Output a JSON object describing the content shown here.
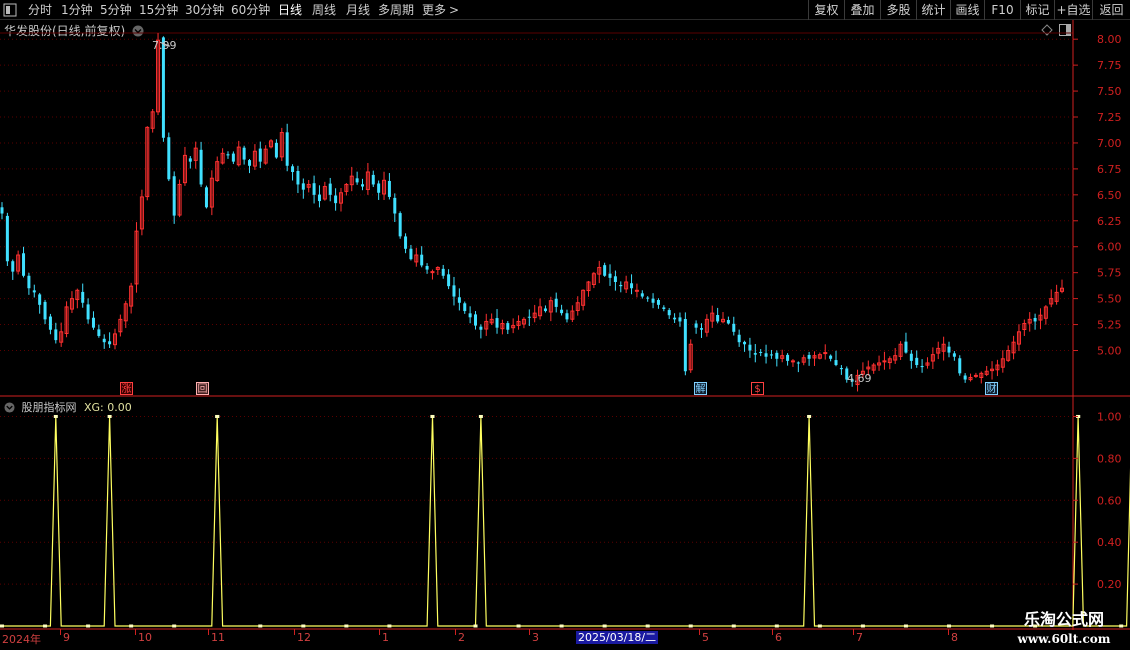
{
  "toolbar": {
    "periods": [
      "分时",
      "1分钟",
      "5分钟",
      "15分钟",
      "30分钟",
      "60分钟",
      "日线",
      "周线",
      "月线",
      "多周期",
      "更多"
    ],
    "more_arrow": ">",
    "active_index": 6,
    "right_buttons": [
      "复权",
      "叠加",
      "多股",
      "统计",
      "画线",
      "F10",
      "标记",
      "+自选",
      "返回"
    ]
  },
  "main_panel": {
    "title": "华发股份(日线,前复权)",
    "high_label": "7.99",
    "low_label": "4.69",
    "events": [
      {
        "label": "涨",
        "color": "#ff4040",
        "bg": "#3a0000"
      },
      {
        "label": "回",
        "color": "#ffb0b0",
        "bg": "#402020"
      },
      {
        "label": "解",
        "color": "#80d0ff",
        "bg": "#102030"
      },
      {
        "label": "$",
        "color": "#ff4040",
        "bg": "#000000"
      },
      {
        "label": "财",
        "color": "#80d0ff",
        "bg": "#102030"
      }
    ]
  },
  "indicator_panel": {
    "name": "股朋指标网",
    "xg_label": "XG: 0.00"
  },
  "date_axis": {
    "labels": [
      "2024年",
      "9",
      "10",
      "11",
      "12",
      "1",
      "2",
      "3",
      "2025/03/18/二",
      "5",
      "6",
      "7",
      "8"
    ]
  },
  "watermark": {
    "line1": "乐淘公式网",
    "line2": "www.60lt.com"
  },
  "colors": {
    "up": "#ff3030",
    "down": "#40e0ff",
    "axis": "#d02020",
    "indicator": "#ffff60",
    "grid": "#5a0000"
  },
  "chart_data": [
    {
      "type": "candlestick",
      "title": "华发股份(日线,前复权)",
      "ylim": [
        4.6,
        8.05
      ],
      "y_ticks": [
        8.0,
        7.75,
        7.5,
        7.25,
        7.0,
        6.75,
        6.5,
        6.25,
        6.0,
        5.75,
        5.5,
        5.25,
        5.0
      ],
      "x_month_labels": [
        "2024年",
        "9",
        "10",
        "11",
        "12",
        "1",
        "2",
        "3",
        "5",
        "6",
        "7",
        "8"
      ],
      "annotations": [
        {
          "text": "7.99",
          "value": 7.99
        },
        {
          "text": "4.69",
          "value": 4.69
        }
      ],
      "close": [
        6.32,
        5.86,
        5.76,
        5.92,
        5.72,
        5.6,
        5.56,
        5.44,
        5.3,
        5.2,
        5.1,
        5.18,
        5.42,
        5.5,
        5.58,
        5.46,
        5.3,
        5.22,
        5.14,
        5.08,
        5.06,
        5.16,
        5.3,
        5.45,
        5.62,
        6.15,
        6.48,
        7.15,
        7.3,
        7.99,
        7.05,
        6.65,
        6.3,
        6.6,
        6.88,
        6.82,
        6.95,
        6.6,
        6.38,
        6.66,
        6.82,
        6.9,
        6.88,
        6.82,
        6.96,
        6.84,
        6.78,
        6.92,
        6.82,
        6.94,
        7.02,
        6.86,
        7.1,
        6.78,
        6.72,
        6.6,
        6.55,
        6.6,
        6.5,
        6.44,
        6.58,
        6.5,
        6.42,
        6.52,
        6.6,
        6.68,
        6.62,
        6.58,
        6.72,
        6.6,
        6.52,
        6.64,
        6.48,
        6.32,
        6.1,
        5.98,
        5.88,
        5.92,
        5.82,
        5.78,
        5.76,
        5.8,
        5.72,
        5.62,
        5.52,
        5.46,
        5.38,
        5.32,
        5.24,
        5.2,
        5.28,
        5.3,
        5.22,
        5.26,
        5.2,
        5.24,
        5.28,
        5.3,
        5.32,
        5.36,
        5.42,
        5.38,
        5.48,
        5.42,
        5.36,
        5.3,
        5.38,
        5.46,
        5.58,
        5.66,
        5.74,
        5.8,
        5.72,
        5.7,
        5.66,
        5.62,
        5.66,
        5.6,
        5.58,
        5.52,
        5.5,
        5.46,
        5.44,
        5.4,
        5.34,
        5.3,
        5.28,
        4.8,
        5.06,
        5.22,
        5.2,
        5.3,
        5.36,
        5.28,
        5.3,
        5.26,
        5.18,
        5.08,
        5.06,
        5.0,
        4.96,
        4.98,
        4.94,
        4.96,
        4.92,
        4.95,
        4.9,
        4.9,
        4.88,
        4.93,
        4.92,
        4.95,
        4.96,
        4.98,
        4.92,
        4.86,
        4.82,
        4.72,
        4.7,
        4.76,
        4.8,
        4.84,
        4.86,
        4.88,
        4.9,
        4.92,
        4.95,
        5.06,
        4.98,
        4.9,
        4.86,
        4.84,
        4.88,
        4.96,
        5.02,
        5.06,
        4.98,
        4.94,
        4.78,
        4.72,
        4.74,
        4.76,
        4.78,
        4.8,
        4.82,
        4.86,
        4.92,
        5.0,
        5.08,
        5.18,
        5.26,
        5.3,
        5.28,
        5.34,
        5.42,
        5.5,
        5.56,
        5.6
      ]
    },
    {
      "type": "line",
      "title": "股朋指标网",
      "ylim": [
        0,
        1.05
      ],
      "y_ticks": [
        1.0,
        0.8,
        0.6,
        0.4,
        0.2
      ],
      "series": [
        {
          "name": "XG",
          "values": [
            0,
            0,
            0,
            0,
            0,
            0,
            0,
            0,
            0,
            0,
            1,
            0,
            0,
            0,
            0,
            0,
            0,
            0,
            0,
            0,
            1,
            0,
            0,
            0,
            0,
            0,
            0,
            0,
            0,
            0,
            0,
            0,
            0,
            0,
            0,
            0,
            0,
            0,
            0,
            0,
            1,
            0,
            0,
            0,
            0,
            0,
            0,
            0,
            0,
            0,
            0,
            0,
            0,
            0,
            0,
            0,
            0,
            0,
            0,
            0,
            0,
            0,
            0,
            0,
            0,
            0,
            0,
            0,
            0,
            0,
            0,
            0,
            0,
            0,
            0,
            0,
            0,
            0,
            0,
            0,
            1,
            0,
            0,
            0,
            0,
            0,
            0,
            0,
            0,
            1,
            0,
            0,
            0,
            0,
            0,
            0,
            0,
            0,
            0,
            0,
            0,
            0,
            0,
            0,
            0,
            0,
            0,
            0,
            0,
            0,
            0,
            0,
            0,
            0,
            0,
            0,
            0,
            0,
            0,
            0,
            0,
            0,
            0,
            0,
            0,
            0,
            0,
            0,
            0,
            0,
            0,
            0,
            0,
            0,
            0,
            0,
            0,
            0,
            0,
            0,
            0,
            0,
            0,
            0,
            0,
            0,
            0,
            0,
            0,
            0,
            1,
            0,
            0,
            0,
            0,
            0,
            0,
            0,
            0,
            0,
            0,
            0,
            0,
            0,
            0,
            0,
            0,
            0,
            0,
            0,
            0,
            0,
            0,
            0,
            0,
            0,
            0,
            0,
            0,
            0,
            0,
            0,
            0,
            0,
            0,
            0,
            0,
            0,
            0,
            0,
            0,
            0,
            0,
            0,
            0,
            0,
            0,
            0,
            0,
            0,
            1,
            0,
            0,
            0,
            0,
            0,
            0,
            0,
            0,
            0,
            1,
            0,
            0,
            0
          ]
        }
      ]
    }
  ]
}
